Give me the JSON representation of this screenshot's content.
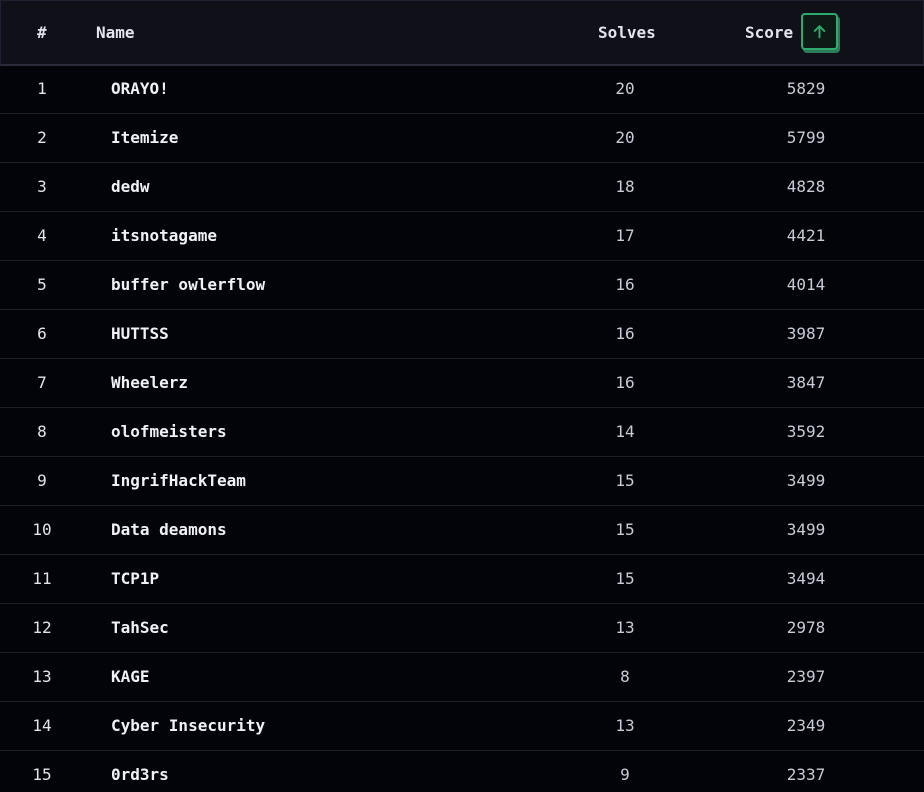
{
  "header": {
    "rank_label": "#",
    "name_label": "Name",
    "solves_label": "Solves",
    "score_label": "Score",
    "sort_icon": "arrow-up-icon",
    "accent_color": "#2faa6f"
  },
  "rows": [
    {
      "rank": "1",
      "name": "ORAYO!",
      "solves": "20",
      "score": "5829"
    },
    {
      "rank": "2",
      "name": "Itemize",
      "solves": "20",
      "score": "5799"
    },
    {
      "rank": "3",
      "name": "dedw",
      "solves": "18",
      "score": "4828"
    },
    {
      "rank": "4",
      "name": "itsnotagame",
      "solves": "17",
      "score": "4421"
    },
    {
      "rank": "5",
      "name": "buffer owlerflow",
      "solves": "16",
      "score": "4014"
    },
    {
      "rank": "6",
      "name": "HUTTSS",
      "solves": "16",
      "score": "3987"
    },
    {
      "rank": "7",
      "name": "Wheelerz",
      "solves": "16",
      "score": "3847"
    },
    {
      "rank": "8",
      "name": "olofmeisters",
      "solves": "14",
      "score": "3592"
    },
    {
      "rank": "9",
      "name": "IngrifHackTeam",
      "solves": "15",
      "score": "3499"
    },
    {
      "rank": "10",
      "name": "Data deamons",
      "solves": "15",
      "score": "3499"
    },
    {
      "rank": "11",
      "name": "TCP1P",
      "solves": "15",
      "score": "3494"
    },
    {
      "rank": "12",
      "name": "TahSec",
      "solves": "13",
      "score": "2978"
    },
    {
      "rank": "13",
      "name": "KAGE",
      "solves": "8",
      "score": "2397"
    },
    {
      "rank": "14",
      "name": "Cyber Insecurity",
      "solves": "13",
      "score": "2349"
    },
    {
      "rank": "15",
      "name": "0rd3rs",
      "solves": "9",
      "score": "2337"
    }
  ]
}
